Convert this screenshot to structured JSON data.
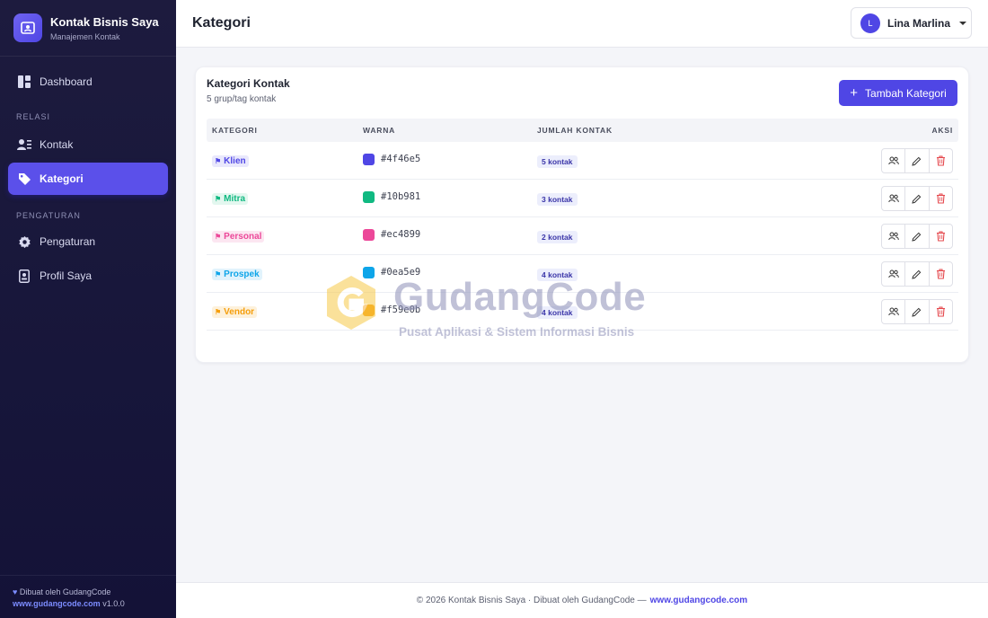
{
  "colors": {
    "accent": "#4f46e5",
    "sidebar_bg": "#1d1b3e",
    "delete": "#e5484d"
  },
  "sidebar": {
    "brand_title": "Kontak Bisnis Saya",
    "brand_subtitle": "Manajemen Kontak",
    "brand_icon": "contact-card-icon",
    "items": [
      {
        "label": "Dashboard",
        "icon": "dashboard-icon"
      },
      {
        "label": "Kontak",
        "icon": "contacts-icon"
      },
      {
        "label": "Kategori",
        "icon": "tag-icon",
        "active": true
      },
      {
        "label": "Pengaturan",
        "icon": "gear-icon"
      },
      {
        "label": "Profil Saya",
        "icon": "id-badge-icon"
      }
    ],
    "sections": [
      "RELASI",
      "PENGATURAN"
    ],
    "footer_credit": "Dibuat oleh GudangCode",
    "footer_link": "www.gudangcode.com",
    "footer_version": "v1.0.0"
  },
  "topbar": {
    "title": "Kategori",
    "user_initial": "L",
    "user_name": "Lina Marlina"
  },
  "card": {
    "title": "Kategori Kontak",
    "subtitle": "5 grup/tag kontak",
    "add_button": "Tambah Kategori",
    "columns": [
      "KATEGORI",
      "WARNA",
      "JUMLAH KONTAK",
      "AKSI"
    ],
    "rows": [
      {
        "name": "Klien",
        "color": "#4f46e5",
        "count": "5 kontak"
      },
      {
        "name": "Mitra",
        "color": "#10b981",
        "count": "3 kontak"
      },
      {
        "name": "Personal",
        "color": "#ec4899",
        "count": "2 kontak"
      },
      {
        "name": "Prospek",
        "color": "#0ea5e9",
        "count": "4 kontak"
      },
      {
        "name": "Vendor",
        "color": "#f59e0b",
        "count": "4 kontak"
      }
    ]
  },
  "watermark": {
    "title": "GudangCode",
    "subtitle": "Pusat Aplikasi & Sistem Informasi Bisnis"
  },
  "footer": {
    "text": "© 2026 Kontak Bisnis Saya · Dibuat oleh GudangCode —",
    "link": "www.gudangcode.com"
  }
}
